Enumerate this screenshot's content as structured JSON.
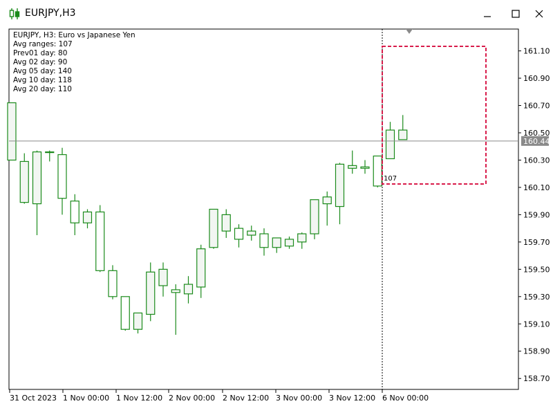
{
  "window": {
    "title": "EURJPY,H3",
    "accent_color": "#1a8a1a"
  },
  "info_panel": {
    "lines": [
      "EURJPY, H3:  Euro vs Japanese Yen",
      "Avg ranges: 107",
      "Prev01 day: 80",
      "Avg 02 day: 90",
      "Avg 05 day: 140",
      "Avg 10 day: 118",
      "Avg 20 day: 110"
    ]
  },
  "chart_data": {
    "type": "candlestick",
    "symbol": "EURJPY",
    "timeframe": "H3",
    "ylim": [
      158.62,
      161.26
    ],
    "y_ticks": [
      "161.10",
      "160.90",
      "160.70",
      "160.50",
      "160.30",
      "160.10",
      "159.90",
      "159.70",
      "159.50",
      "159.30",
      "159.10",
      "158.90",
      "158.70"
    ],
    "x_ticks": [
      "31 Oct 2023",
      "1 Nov 00:00",
      "1 Nov 12:00",
      "2 Nov 00:00",
      "2 Nov 12:00",
      "3 Nov 00:00",
      "3 Nov 12:00",
      "6 Nov 00:00"
    ],
    "current_price": "160.44",
    "current_price_value": 160.44,
    "range_label": "107",
    "candles": [
      {
        "o": 160.3,
        "h": 160.72,
        "l": 160.3,
        "c": 160.72
      },
      {
        "o": 159.99,
        "h": 160.35,
        "l": 159.98,
        "c": 160.29
      },
      {
        "o": 159.98,
        "h": 160.37,
        "l": 159.75,
        "c": 160.36
      },
      {
        "o": 160.36,
        "h": 160.37,
        "l": 160.29,
        "c": 160.36
      },
      {
        "o": 160.34,
        "h": 160.39,
        "l": 159.9,
        "c": 160.02
      },
      {
        "o": 160.0,
        "h": 160.05,
        "l": 159.75,
        "c": 159.84
      },
      {
        "o": 159.84,
        "h": 159.94,
        "l": 159.8,
        "c": 159.92
      },
      {
        "o": 159.92,
        "h": 159.97,
        "l": 159.48,
        "c": 159.49
      },
      {
        "o": 159.49,
        "h": 159.53,
        "l": 159.28,
        "c": 159.3
      },
      {
        "o": 159.3,
        "h": 159.3,
        "l": 159.05,
        "c": 159.06
      },
      {
        "o": 159.06,
        "h": 159.17,
        "l": 159.03,
        "c": 159.18
      },
      {
        "o": 159.17,
        "h": 159.55,
        "l": 159.12,
        "c": 159.48
      },
      {
        "o": 159.38,
        "h": 159.55,
        "l": 159.3,
        "c": 159.5
      },
      {
        "o": 159.35,
        "h": 159.39,
        "l": 159.02,
        "c": 159.33
      },
      {
        "o": 159.32,
        "h": 159.45,
        "l": 159.25,
        "c": 159.39
      },
      {
        "o": 159.37,
        "h": 159.68,
        "l": 159.29,
        "c": 159.65
      },
      {
        "o": 159.66,
        "h": 159.85,
        "l": 159.65,
        "c": 159.94
      },
      {
        "o": 159.78,
        "h": 159.94,
        "l": 159.73,
        "c": 159.9
      },
      {
        "o": 159.8,
        "h": 159.83,
        "l": 159.66,
        "c": 159.72
      },
      {
        "o": 159.75,
        "h": 159.82,
        "l": 159.71,
        "c": 159.78
      },
      {
        "o": 159.76,
        "h": 159.8,
        "l": 159.6,
        "c": 159.66
      },
      {
        "o": 159.66,
        "h": 159.73,
        "l": 159.62,
        "c": 159.73
      },
      {
        "o": 159.67,
        "h": 159.74,
        "l": 159.65,
        "c": 159.72
      },
      {
        "o": 159.7,
        "h": 159.77,
        "l": 159.65,
        "c": 159.76
      },
      {
        "o": 159.76,
        "h": 160.0,
        "l": 159.72,
        "c": 160.01
      },
      {
        "o": 159.98,
        "h": 160.07,
        "l": 159.82,
        "c": 160.03
      },
      {
        "o": 159.96,
        "h": 160.28,
        "l": 159.83,
        "c": 160.27
      },
      {
        "o": 160.24,
        "h": 160.37,
        "l": 160.2,
        "c": 160.26
      },
      {
        "o": 160.25,
        "h": 160.3,
        "l": 160.2,
        "c": 160.24
      },
      {
        "o": 160.33,
        "h": 160.33,
        "l": 160.1,
        "c": 160.11
      },
      {
        "o": 160.31,
        "h": 160.58,
        "l": 160.31,
        "c": 160.52
      },
      {
        "o": 160.45,
        "h": 160.63,
        "l": 160.45,
        "c": 160.52
      }
    ]
  }
}
